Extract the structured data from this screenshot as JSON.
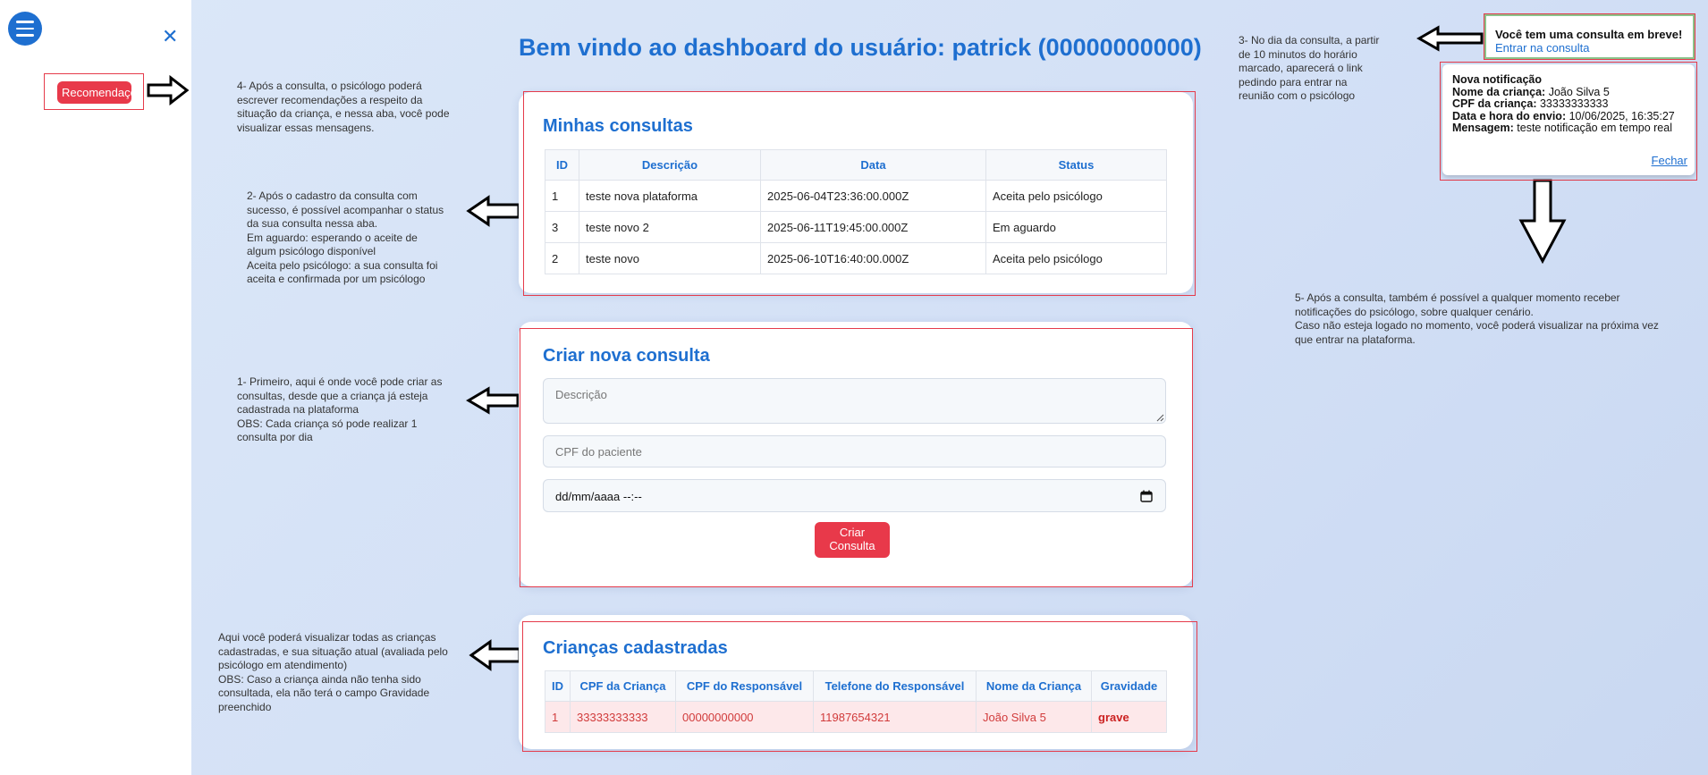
{
  "sidebar": {
    "menu_icon": "hamburger-icon",
    "close_icon": "close-icon",
    "close_glyph": "✕",
    "recommend_button": "Recomendações"
  },
  "header": {
    "title": "Bem vindo ao dashboard do usuário: patrick (00000000000)"
  },
  "consultas": {
    "heading": "Minhas consultas",
    "columns": [
      "ID",
      "Descrição",
      "Data",
      "Status"
    ],
    "rows": [
      [
        "1",
        "teste nova plataforma",
        "2025-06-04T23:36:00.000Z",
        "Aceita pelo psicólogo"
      ],
      [
        "3",
        "teste novo 2",
        "2025-06-11T19:45:00.000Z",
        "Em aguardo"
      ],
      [
        "2",
        "teste novo",
        "2025-06-10T16:40:00.000Z",
        "Aceita pelo psicólogo"
      ]
    ]
  },
  "nova_consulta": {
    "heading": "Criar nova consulta",
    "descricao_placeholder": "Descrição",
    "cpf_placeholder": "CPF do paciente",
    "datetime_value": "dd/mm/aaaa --:--",
    "submit_line1": "Criar",
    "submit_line2": "Consulta"
  },
  "criancas": {
    "heading": "Crianças cadastradas",
    "columns": [
      "ID",
      "CPF da Criança",
      "CPF do Responsável",
      "Telefone do Responsável",
      "Nome da Criança",
      "Gravidade"
    ],
    "rows": [
      [
        "1",
        "33333333333",
        "00000000000",
        "11987654321",
        "João Silva 5",
        "grave"
      ]
    ]
  },
  "toast_consulta": {
    "title": "Você tem uma consulta em breve!",
    "link": "Entrar na consulta"
  },
  "notificacao": {
    "title": "Nova notificação",
    "nome_label": "Nome da criança:",
    "nome_value": "João Silva 5",
    "cpf_label": "CPF da criança:",
    "cpf_value": "33333333333",
    "data_label": "Data e hora do envio:",
    "data_value": "10/06/2025, 16:35:27",
    "msg_label": "Mensagem:",
    "msg_value": "teste notificação em tempo real",
    "close_link": "Fechar"
  },
  "annotations": {
    "n4": "4- Após a consulta, o psicólogo poderá\nescrever recomendações a respeito da\nsituação da criança, e nessa aba, você pode\nvisualizar essas mensagens.",
    "n2": "2- Após o cadastro da consulta com\nsucesso, é possível acompanhar o status\nda sua consulta nessa aba.\nEm aguardo: esperando o aceite de\nalgum psicólogo disponível\nAceita pelo psicólogo: a sua consulta foi\naceita e confirmada por um psicólogo",
    "n1": "1- Primeiro, aqui é onde você pode criar as\nconsultas, desde que a criança já esteja\ncadastrada na plataforma\nOBS: Cada criança só pode realizar 1\nconsulta por dia",
    "nc": "Aqui você poderá visualizar todas as crianças\ncadastradas, e sua situação atual (avaliada pelo\npsicólogo em atendimento)\nOBS: Caso a criança ainda não tenha sido\nconsultada, ela não terá o campo Gravidade\npreenchido",
    "n3": "3- No dia da consulta, a partir\nde 10 minutos do horário\nmarcado, aparecerá o link\npedindo para entrar na\nreunião com o psicólogo",
    "n5": "5- Após a consulta, também é possível a qualquer momento receber\nnotificações do psicólogo, sobre qualquer cenário.\nCaso não esteja logado no momento, você poderá visualizar na próxima vez\nque entrar na plataforma."
  },
  "colors": {
    "accent": "#1e6fd0",
    "danger": "#e8394a",
    "annotation_frame": "#e53b4b"
  }
}
